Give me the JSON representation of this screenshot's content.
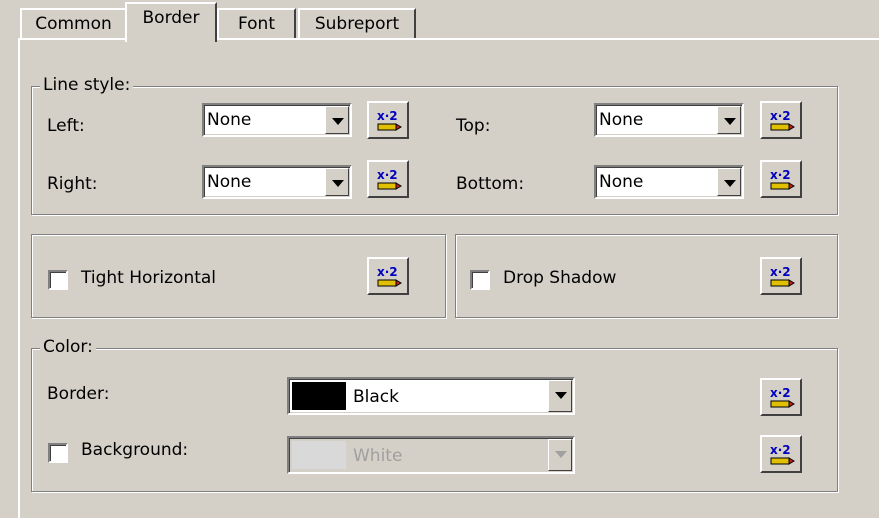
{
  "tabs": [
    {
      "label": "Common"
    },
    {
      "label": "Border"
    },
    {
      "label": "Font"
    },
    {
      "label": "Subreport"
    }
  ],
  "active_tab": "Border",
  "line_style": {
    "legend": "Line style:",
    "left": {
      "label": "Left:",
      "value": "None"
    },
    "right": {
      "label": "Right:",
      "value": "None"
    },
    "top": {
      "label": "Top:",
      "value": "None"
    },
    "bottom": {
      "label": "Bottom:",
      "value": "None"
    }
  },
  "options": {
    "tight_horizontal": {
      "label": "Tight Horizontal",
      "checked": false
    },
    "drop_shadow": {
      "label": "Drop Shadow",
      "checked": false
    }
  },
  "color": {
    "legend": "Color:",
    "border": {
      "label": "Border:",
      "value": "Black",
      "swatch": "#000000"
    },
    "background": {
      "label": "Background:",
      "value": "White",
      "swatch": "#d9d9d9",
      "checked": false,
      "enabled": false
    }
  },
  "formula_button_icon": "formula-icon"
}
